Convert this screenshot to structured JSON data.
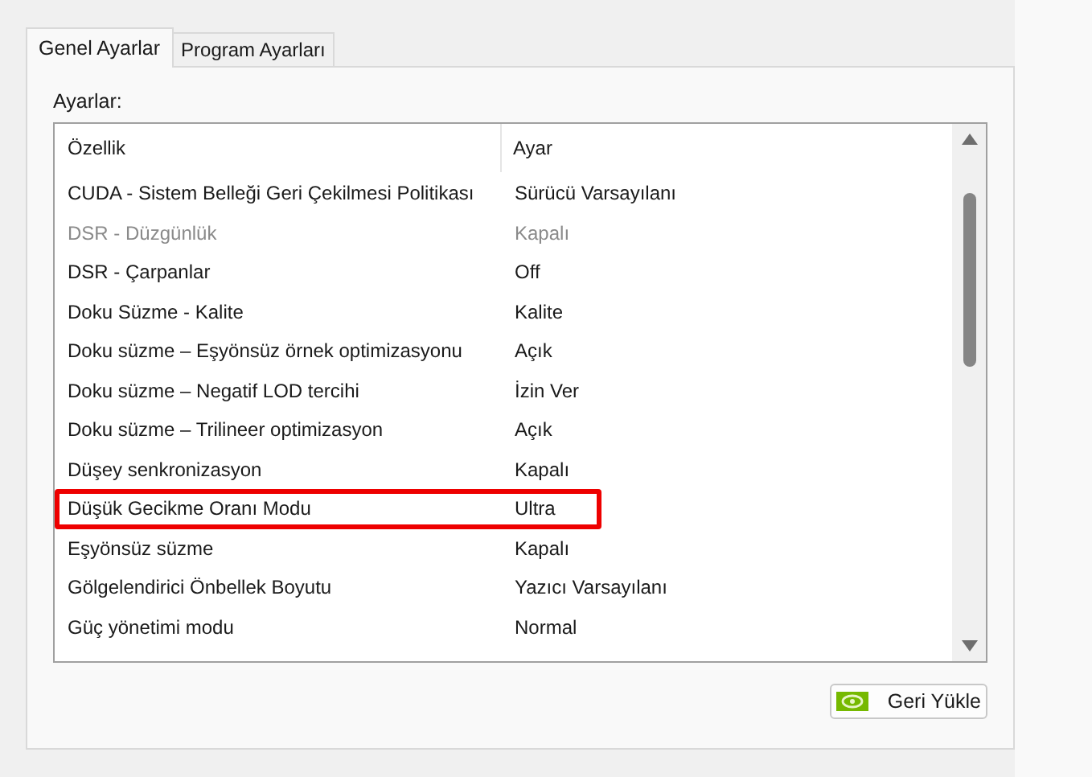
{
  "tabs": [
    {
      "label": "Genel Ayarlar",
      "selected": true
    },
    {
      "label": "Program Ayarları",
      "selected": false
    }
  ],
  "settings_label": "Ayarlar:",
  "table": {
    "columns": [
      "Özellik",
      "Ayar"
    ],
    "rows": [
      {
        "feature": "CUDA - Sistem Belleği Geri Çekilmesi Politikası",
        "value": "Sürücü Varsayılanı",
        "disabled": false,
        "highlighted": false
      },
      {
        "feature": "DSR - Düzgünlük",
        "value": "Kapalı",
        "disabled": true,
        "highlighted": false
      },
      {
        "feature": "DSR - Çarpanlar",
        "value": "Off",
        "disabled": false,
        "highlighted": false
      },
      {
        "feature": "Doku Süzme - Kalite",
        "value": "Kalite",
        "disabled": false,
        "highlighted": false
      },
      {
        "feature": "Doku süzme – Eşyönsüz örnek optimizasyonu",
        "value": "Açık",
        "disabled": false,
        "highlighted": false
      },
      {
        "feature": "Doku süzme – Negatif LOD tercihi",
        "value": "İzin Ver",
        "disabled": false,
        "highlighted": false
      },
      {
        "feature": "Doku süzme – Trilineer optimizasyon",
        "value": "Açık",
        "disabled": false,
        "highlighted": false
      },
      {
        "feature": "Düşey senkronizasyon",
        "value": "Kapalı",
        "disabled": false,
        "highlighted": false
      },
      {
        "feature": "Düşük Gecikme Oranı Modu",
        "value": "Ultra",
        "disabled": false,
        "highlighted": true
      },
      {
        "feature": "Eşyönsüz süzme",
        "value": "Kapalı",
        "disabled": false,
        "highlighted": false
      },
      {
        "feature": "Gölgelendirici Önbellek Boyutu",
        "value": "Yazıcı Varsayılanı",
        "disabled": false,
        "highlighted": false
      },
      {
        "feature": "Güç yönetimi modu",
        "value": "Normal",
        "disabled": false,
        "highlighted": false
      }
    ]
  },
  "restore_button": "Geri Yükle"
}
